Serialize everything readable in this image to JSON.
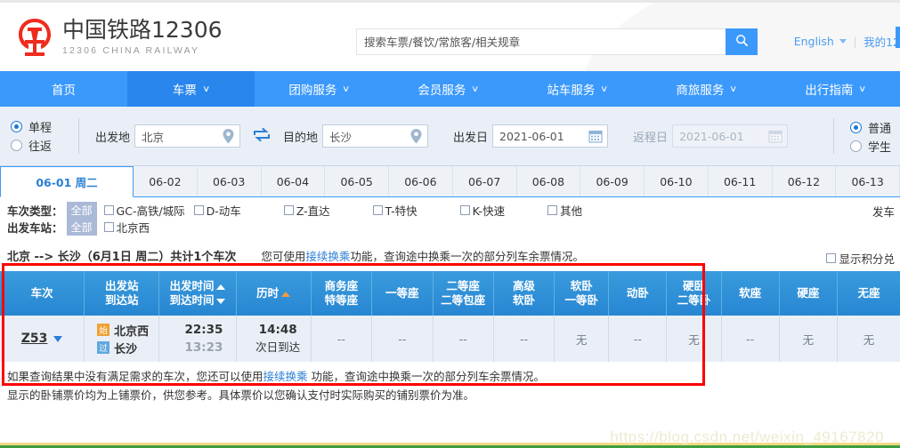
{
  "header": {
    "logo_cn": "中国铁路12306",
    "logo_en": "12306 CHINA RAILWAY",
    "search_placeholder": "搜索车票/餐饮/常旅客/相关规章",
    "search_value": "",
    "search_icon": "search-icon",
    "language_label": "English",
    "my_account_label": "我的12"
  },
  "nav": {
    "items": [
      {
        "label": "首页",
        "has_caret": false,
        "active": false
      },
      {
        "label": "车票",
        "has_caret": true,
        "active": true
      },
      {
        "label": "团购服务",
        "has_caret": true,
        "active": false
      },
      {
        "label": "会员服务",
        "has_caret": true,
        "active": false
      },
      {
        "label": "站车服务",
        "has_caret": true,
        "active": false
      },
      {
        "label": "商旅服务",
        "has_caret": true,
        "active": false
      },
      {
        "label": "出行指南",
        "has_caret": true,
        "active": false
      }
    ]
  },
  "query": {
    "trip_types": [
      {
        "label": "单程",
        "selected": true
      },
      {
        "label": "往返",
        "selected": false
      }
    ],
    "from_label": "出发地",
    "from_value": "北京",
    "to_label": "目的地",
    "to_value": "长沙",
    "swap_icon": "swap-icon",
    "location_icon": "location-pin-icon",
    "depart_date_label": "出发日",
    "depart_date_value": "2021-06-01",
    "return_date_label": "返程日",
    "return_date_value": "2021-06-01",
    "calendar_icon": "calendar-icon",
    "passenger_types": [
      {
        "label": "普通",
        "selected": true
      },
      {
        "label": "学生",
        "selected": false
      }
    ]
  },
  "date_tabs": [
    {
      "label": "06-01 周二",
      "active": true
    },
    {
      "label": "06-02",
      "active": false
    },
    {
      "label": "06-03",
      "active": false
    },
    {
      "label": "06-04",
      "active": false
    },
    {
      "label": "06-05",
      "active": false
    },
    {
      "label": "06-06",
      "active": false
    },
    {
      "label": "06-07",
      "active": false
    },
    {
      "label": "06-08",
      "active": false
    },
    {
      "label": "06-09",
      "active": false
    },
    {
      "label": "06-10",
      "active": false
    },
    {
      "label": "06-11",
      "active": false
    },
    {
      "label": "06-12",
      "active": false
    },
    {
      "label": "06-13",
      "active": false
    }
  ],
  "filters": {
    "train_type_title": "车次类型：",
    "train_type_all": "全部",
    "train_types": [
      {
        "label": "GC-高铁/城际",
        "checked": false
      },
      {
        "label": "D-动车",
        "checked": false
      },
      {
        "label": "Z-直达",
        "checked": false
      },
      {
        "label": "T-特快",
        "checked": false
      },
      {
        "label": "K-快速",
        "checked": false
      },
      {
        "label": "其他",
        "checked": false
      }
    ],
    "station_title": "出发车站：",
    "station_all": "全部",
    "stations": [
      {
        "label": "北京西",
        "checked": false
      }
    ],
    "depart_time_label": "发车"
  },
  "result_note": {
    "route_summary": "北京 --> 长沙（6月1日 周二）共计1个车次",
    "note_prefix": "您可使用",
    "note_link": "接续换乘",
    "note_suffix": "功能，查询途中换乘一次的部分列车余票情况。",
    "show_points_label": "显示积分兑",
    "show_points_checked": false
  },
  "table": {
    "columns": [
      {
        "line1": "车次",
        "line2": "",
        "sort": ""
      },
      {
        "line1": "出发站",
        "line2": "到达站",
        "sort": ""
      },
      {
        "line1": "出发时间",
        "line2": "到达时间",
        "sort": "updown"
      },
      {
        "line1": "历时",
        "line2": "",
        "sort": "up-orange"
      },
      {
        "line1": "商务座",
        "line2": "特等座",
        "sort": ""
      },
      {
        "line1": "一等座",
        "line2": "",
        "sort": ""
      },
      {
        "line1": "二等座",
        "line2": "二等包座",
        "sort": ""
      },
      {
        "line1": "高级",
        "line2": "软卧",
        "sort": ""
      },
      {
        "line1": "软卧",
        "line2": "一等卧",
        "sort": ""
      },
      {
        "line1": "动卧",
        "line2": "",
        "sort": ""
      },
      {
        "line1": "硬卧",
        "line2": "二等卧",
        "sort": ""
      },
      {
        "line1": "软座",
        "line2": "",
        "sort": ""
      },
      {
        "line1": "硬座",
        "line2": "",
        "sort": ""
      },
      {
        "line1": "无座",
        "line2": "",
        "sort": ""
      }
    ],
    "rows": [
      {
        "train_code": "Z53",
        "from_station": "北京西",
        "to_station": "长沙",
        "from_badge": "始",
        "to_badge": "过",
        "depart_time": "22:35",
        "arrive_time": "13:23",
        "duration": "14:48",
        "arrive_note": "次日到达",
        "seats": [
          "--",
          "--",
          "--",
          "--",
          "无",
          "--",
          "无",
          "--",
          "无",
          "无"
        ]
      }
    ]
  },
  "footer": {
    "line1_a": "如果查询结果中没有满足需求的车次，您还可以使用",
    "line1_link": "接续换乘",
    "line1_b": " 功能，查询途中换乘一次的部分列车余票情况。",
    "line2": "显示的卧铺票价均为上铺票价，供您参考。具体票价以您确认支付时实际购买的铺别票价为准。"
  },
  "watermark": "https://blog.csdn.net/weixin_49167820"
}
